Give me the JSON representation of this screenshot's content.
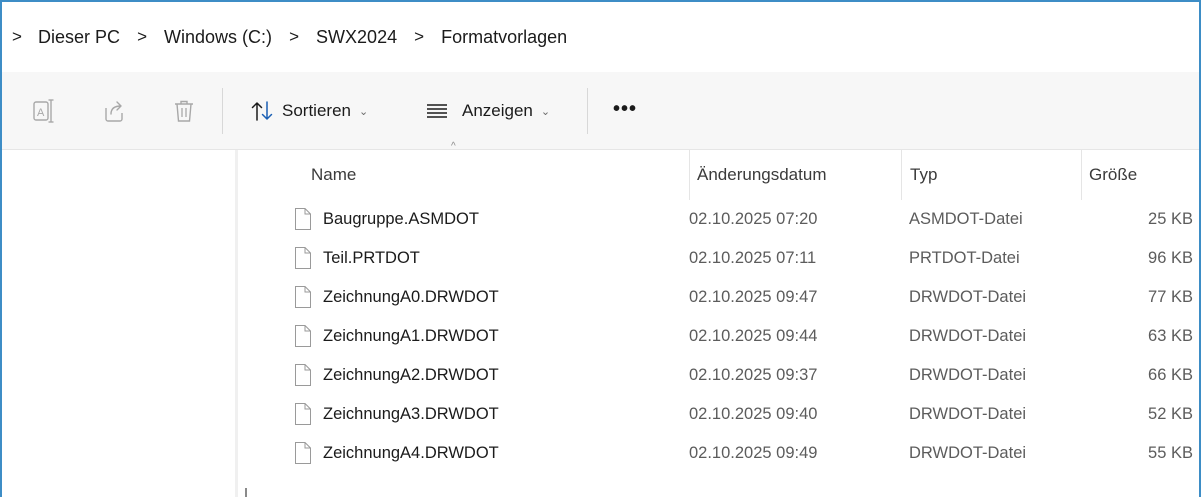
{
  "breadcrumb": {
    "items": [
      "Dieser PC",
      "Windows (C:)",
      "SWX2024",
      "Formatvorlagen"
    ],
    "separator": ">"
  },
  "toolbar": {
    "icons": [
      "rename-icon",
      "share-icon",
      "delete-icon"
    ],
    "sort_label": "Sortieren",
    "view_label": "Anzeigen",
    "chevron": "⌄",
    "more_label": "•••"
  },
  "columns": {
    "name": "Name",
    "date": "Änderungsdatum",
    "type": "Typ",
    "size": "Größe",
    "sort_indicator": "^"
  },
  "files": [
    {
      "name": "Baugruppe.ASMDOT",
      "date": "02.10.2025 07:20",
      "type": "ASMDOT-Datei",
      "size": "25 KB"
    },
    {
      "name": "Teil.PRTDOT",
      "date": "02.10.2025 07:11",
      "type": "PRTDOT-Datei",
      "size": "96 KB"
    },
    {
      "name": "ZeichnungA0.DRWDOT",
      "date": "02.10.2025 09:47",
      "type": "DRWDOT-Datei",
      "size": "77 KB"
    },
    {
      "name": "ZeichnungA1.DRWDOT",
      "date": "02.10.2025 09:44",
      "type": "DRWDOT-Datei",
      "size": "63 KB"
    },
    {
      "name": "ZeichnungA2.DRWDOT",
      "date": "02.10.2025 09:37",
      "type": "DRWDOT-Datei",
      "size": "66 KB"
    },
    {
      "name": "ZeichnungA3.DRWDOT",
      "date": "02.10.2025 09:40",
      "type": "DRWDOT-Datei",
      "size": "52 KB"
    },
    {
      "name": "ZeichnungA4.DRWDOT",
      "date": "02.10.2025 09:49",
      "type": "DRWDOT-Datei",
      "size": "55 KB"
    }
  ],
  "colors": {
    "accent_border": "#3d8dc6",
    "sort_icon": "#1a5fb4"
  }
}
